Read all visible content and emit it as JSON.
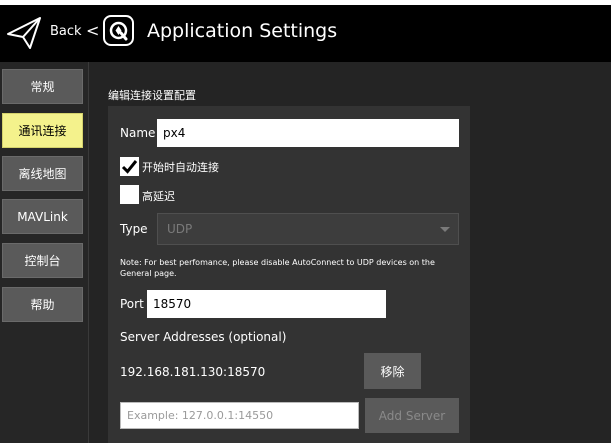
{
  "toolbar": {
    "back_label": "Back",
    "chevron": "<",
    "title": "Application Settings",
    "icons": {
      "vehicle": "paper-plane-icon",
      "app": "qgc-logo-icon"
    }
  },
  "nav": {
    "items": [
      {
        "label": "常规",
        "active": false
      },
      {
        "label": "通讯连接",
        "active": true
      },
      {
        "label": "离线地图",
        "active": false
      },
      {
        "label": "MAVLink",
        "active": false
      },
      {
        "label": "控制台",
        "active": false
      },
      {
        "label": "帮助",
        "active": false
      }
    ]
  },
  "editor": {
    "section_title": "编辑连接设置配置",
    "name_label": "Name",
    "name_value": "px4",
    "autoconnect_label": "开始时自动连接",
    "autoconnect_checked": true,
    "highlatency_label": "高延迟",
    "highlatency_checked": false,
    "type_label": "Type",
    "type_value": "UDP",
    "note": "Note: For best perfomance, please disable AutoConnect to UDP devices on the General page.",
    "port_label": "Port",
    "port_value": "18570",
    "servers_label": "Server Addresses (optional)",
    "server_address": "192.168.181.130:18570",
    "remove_label": "移除",
    "server_placeholder": "Example: 127.0.0.1:14550",
    "add_server_label": "Add Server"
  },
  "colors": {
    "active_nav": "#f4f28c",
    "button": "#5a5a5a",
    "panel": "#333333",
    "toolbar": "#000000"
  }
}
